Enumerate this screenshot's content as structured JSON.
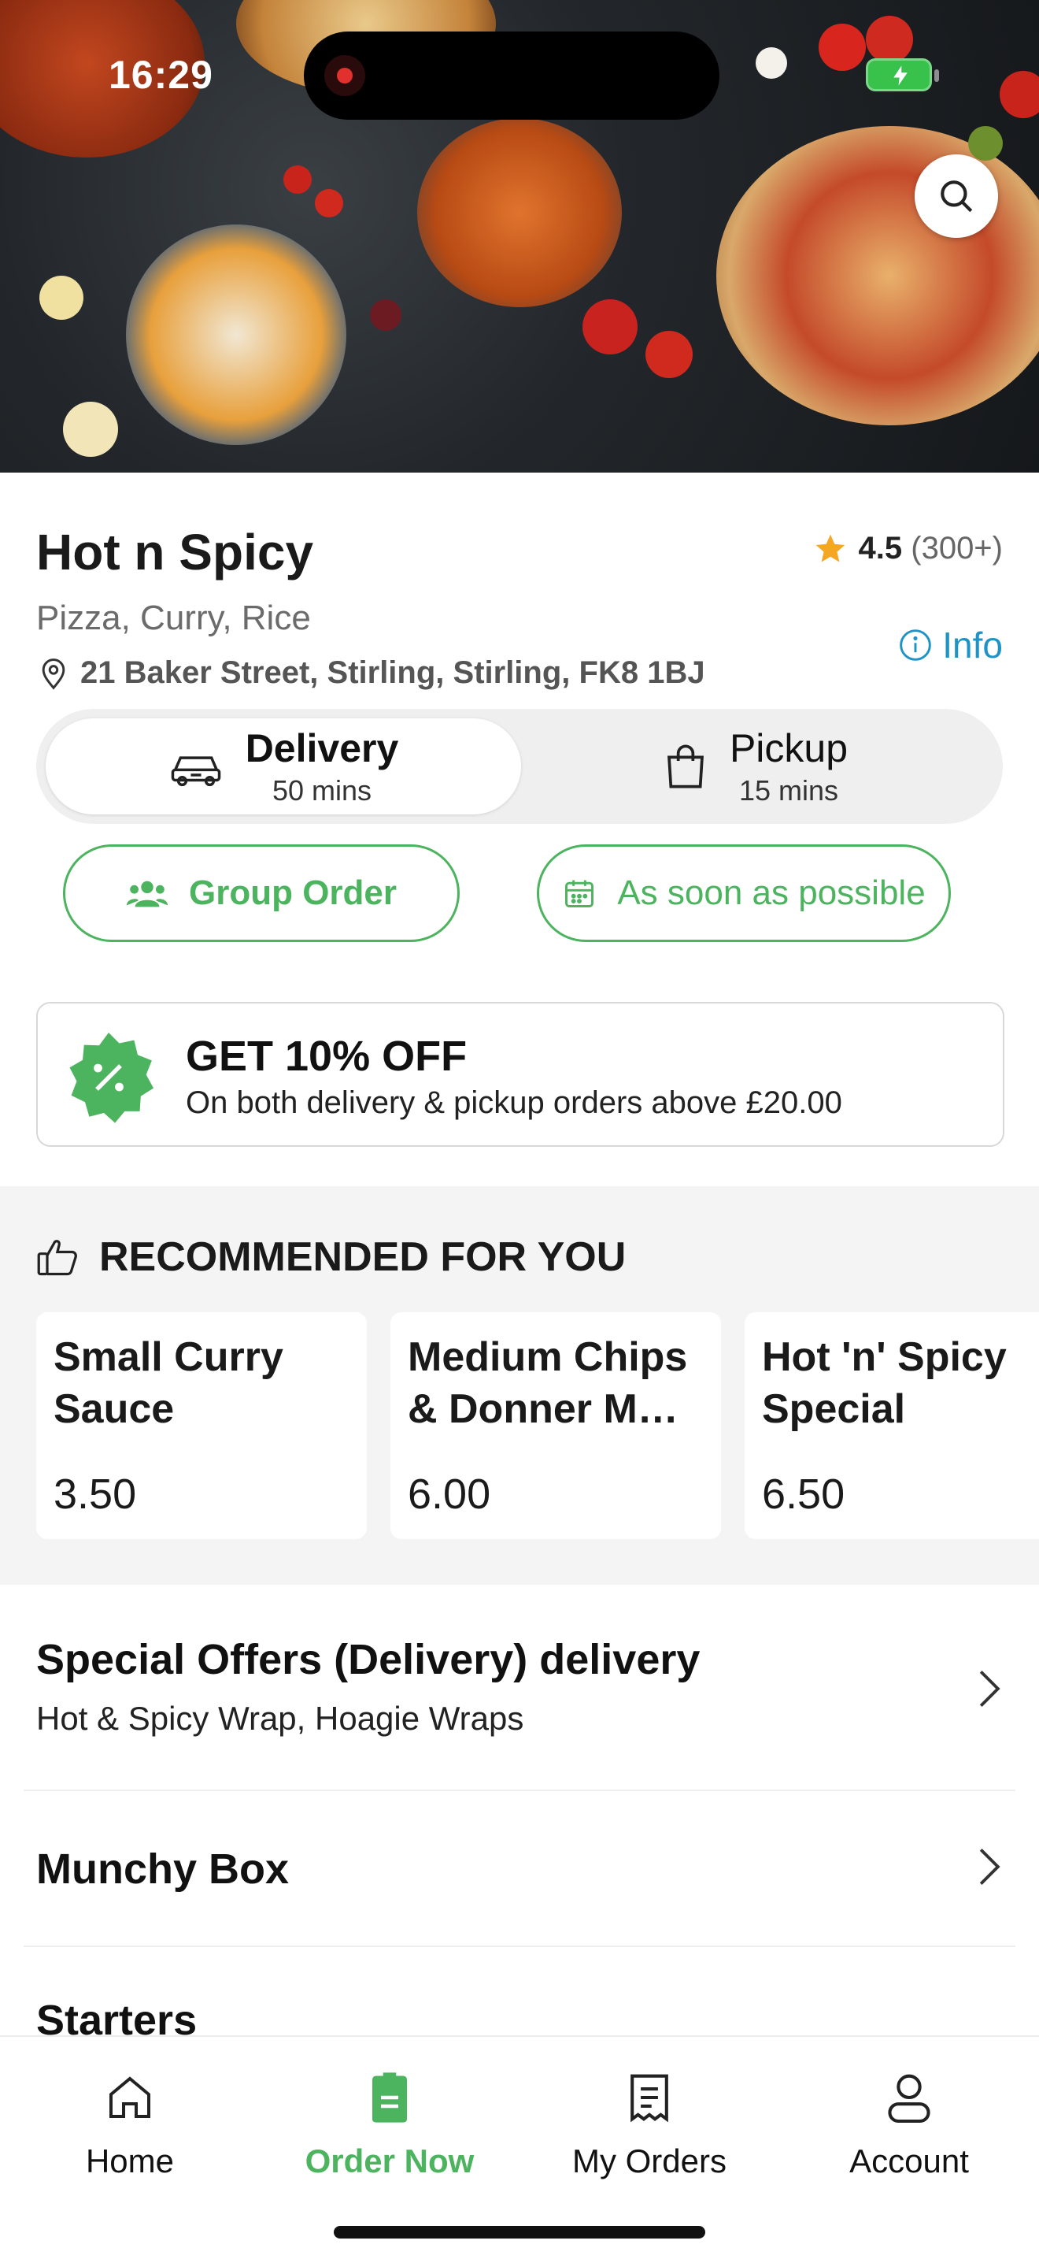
{
  "status_bar": {
    "time": "16:29"
  },
  "restaurant": {
    "name": "Hot n Spicy",
    "rating": "4.5",
    "rating_count": "(300+)",
    "cuisines": "Pizza, Curry, Rice",
    "info_label": "Info",
    "address": "21 Baker Street, Stirling, Stirling, FK8 1BJ"
  },
  "order_mode": {
    "delivery": {
      "label": "Delivery",
      "time": "50 mins"
    },
    "pickup": {
      "label": "Pickup",
      "time": "15 mins"
    },
    "selected": "delivery"
  },
  "actions": {
    "group_order": "Group Order",
    "schedule": "As soon as possible"
  },
  "offer": {
    "title": "GET 10% OFF",
    "subtitle": "On both delivery & pickup orders above £20.00"
  },
  "recommended": {
    "title": "RECOMMENDED FOR YOU",
    "items": [
      {
        "name": "Small Curry Sauce",
        "price": "3.50"
      },
      {
        "name": "Medium Chips & Donner M…",
        "price": "6.00"
      },
      {
        "name": "Hot 'n' Spicy Special Nach…",
        "price": "6.50"
      }
    ]
  },
  "categories": [
    {
      "name": "Special Offers (Delivery) delivery",
      "subtitle": "Hot & Spicy Wrap, Hoagie Wraps"
    },
    {
      "name": "Munchy Box"
    },
    {
      "name": "Starters"
    }
  ],
  "bottom_nav": [
    {
      "label": "Home",
      "icon": "home-icon"
    },
    {
      "label": "Order Now",
      "icon": "order-icon",
      "active": true
    },
    {
      "label": "My Orders",
      "icon": "receipt-icon"
    },
    {
      "label": "Account",
      "icon": "person-icon"
    }
  ],
  "colors": {
    "accent_green": "#4cb35e",
    "info_blue": "#1e93c6",
    "star": "#f5a623"
  }
}
